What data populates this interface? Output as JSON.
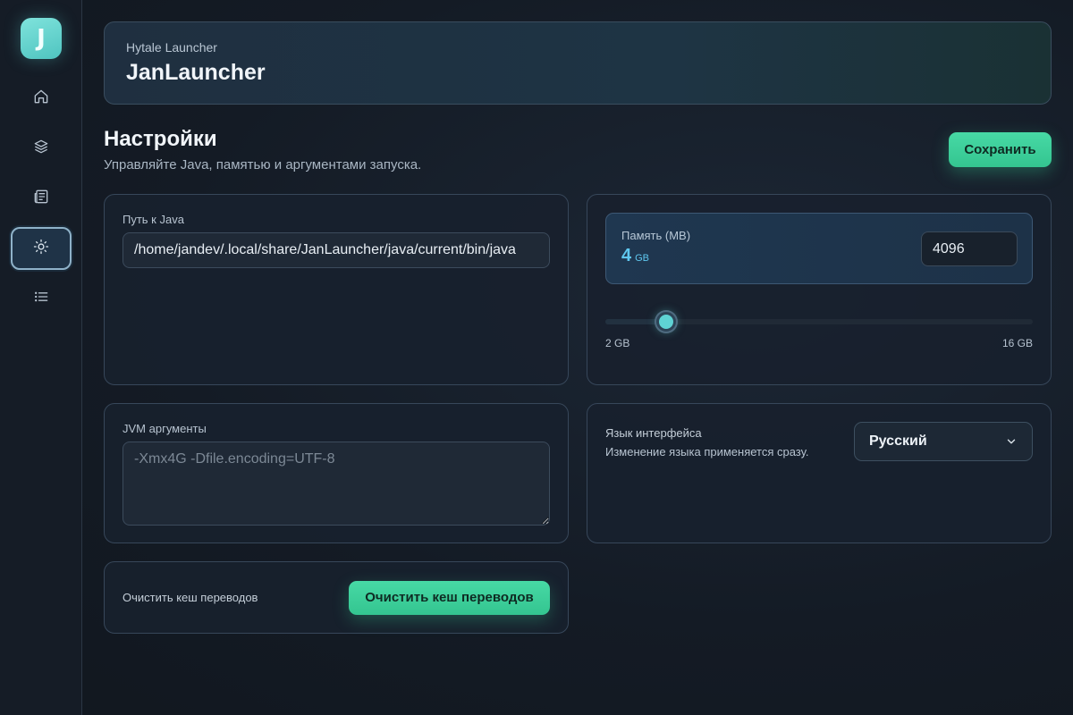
{
  "sidebar": {
    "logo_letter": "J",
    "items": [
      {
        "name": "home",
        "icon": "home-icon",
        "active": false
      },
      {
        "name": "layers",
        "icon": "layers-icon",
        "active": false
      },
      {
        "name": "news",
        "icon": "newspaper-icon",
        "active": false
      },
      {
        "name": "settings",
        "icon": "settings-icon",
        "active": true
      },
      {
        "name": "list",
        "icon": "list-icon",
        "active": false
      }
    ]
  },
  "header": {
    "subtitle": "Hytale Launcher",
    "title": "JanLauncher"
  },
  "page": {
    "title": "Настройки",
    "subtitle": "Управляйте Java, памятью и аргументами запуска.",
    "save_label": "Сохранить"
  },
  "java": {
    "label": "Путь к Java",
    "value": "/home/jandev/.local/share/JanLauncher/java/current/bin/java"
  },
  "memory": {
    "label": "Память (MB)",
    "value_gb": "4",
    "unit": "GB",
    "input_value": "4096",
    "slider_min_label": "2 GB",
    "slider_max_label": "16 GB",
    "slider_min_mb": 2048,
    "slider_max_mb": 16384,
    "slider_value_mb": 4096
  },
  "jvm": {
    "label": "JVM аргументы",
    "placeholder": "-Xmx4G -Dfile.encoding=UTF-8"
  },
  "language": {
    "title": "Язык интерфейса",
    "description": "Изменение языка применяется сразу.",
    "selected": "Русский"
  },
  "cache": {
    "label": "Очистить кеш переводов",
    "button_label": "Очистить кеш переводов"
  },
  "colors": {
    "accent": "#3fd19c",
    "teal": "#5fd3d4",
    "memory_value": "#5fc8f0"
  }
}
